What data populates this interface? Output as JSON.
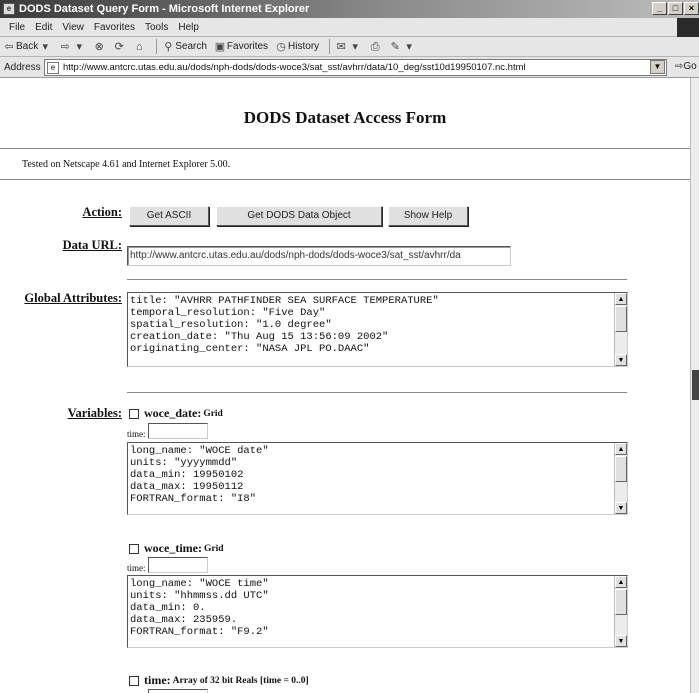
{
  "window": {
    "title": "DODS Dataset Query Form - Microsoft Internet Explorer",
    "controls": [
      "_",
      "□",
      "×"
    ]
  },
  "menu": [
    "File",
    "Edit",
    "View",
    "Favorites",
    "Tools",
    "Help"
  ],
  "toolbar": {
    "back": "Back",
    "search": "Search",
    "favorites": "Favorites",
    "history": "History"
  },
  "address": {
    "label": "Address",
    "url": "http://www.antcrc.utas.edu.au/dods/nph-dods/dods-woce3/sat_sst/avhrr/data/10_deg/sst10d19950107.nc.html",
    "go": "Go"
  },
  "page": {
    "title": "DODS Dataset Access Form",
    "tested": "Tested on Netscape 4.61 and Internet Explorer 5.00.",
    "action_label": "Action:",
    "buttons": {
      "ascii": "Get ASCII",
      "dods": "Get DODS Data Object",
      "help": "Show Help"
    },
    "data_url_label": "Data URL:",
    "data_url_value": "http://www.antcrc.utas.edu.au/dods/nph-dods/dods-woce3/sat_sst/avhrr/da",
    "global_attributes_label": "Global Attributes:",
    "global_attributes": "title: \"AVHRR PATHFINDER SEA SURFACE TEMPERATURE\"\ntemporal_resolution: \"Five Day\"\nspatial_resolution: \"1.0 degree\"\ncreation_date: \"Thu Aug 15 13:56:09 2002\"\noriginating_center: \"NASA JPL PO.DAAC\"",
    "variables_label": "Variables:",
    "variables": [
      {
        "name": "woce_date:",
        "type": "Grid",
        "dim": "time:",
        "attributes": "long_name: \"WOCE date\"\nunits: \"yyyymmdd\"\ndata_min: 19950102\ndata_max: 19950112\nFORTRAN_format: \"I8\""
      },
      {
        "name": "woce_time:",
        "type": "Grid",
        "dim": "time:",
        "attributes": "long_name: \"WOCE time\"\nunits: \"hhmmss.dd UTC\"\ndata_min: 0.\ndata_max: 235959.\nFORTRAN_format: \"F9.2\""
      },
      {
        "name": "time:",
        "type": "Array of 32 bit Reals [time = 0..0]"
      }
    ]
  }
}
